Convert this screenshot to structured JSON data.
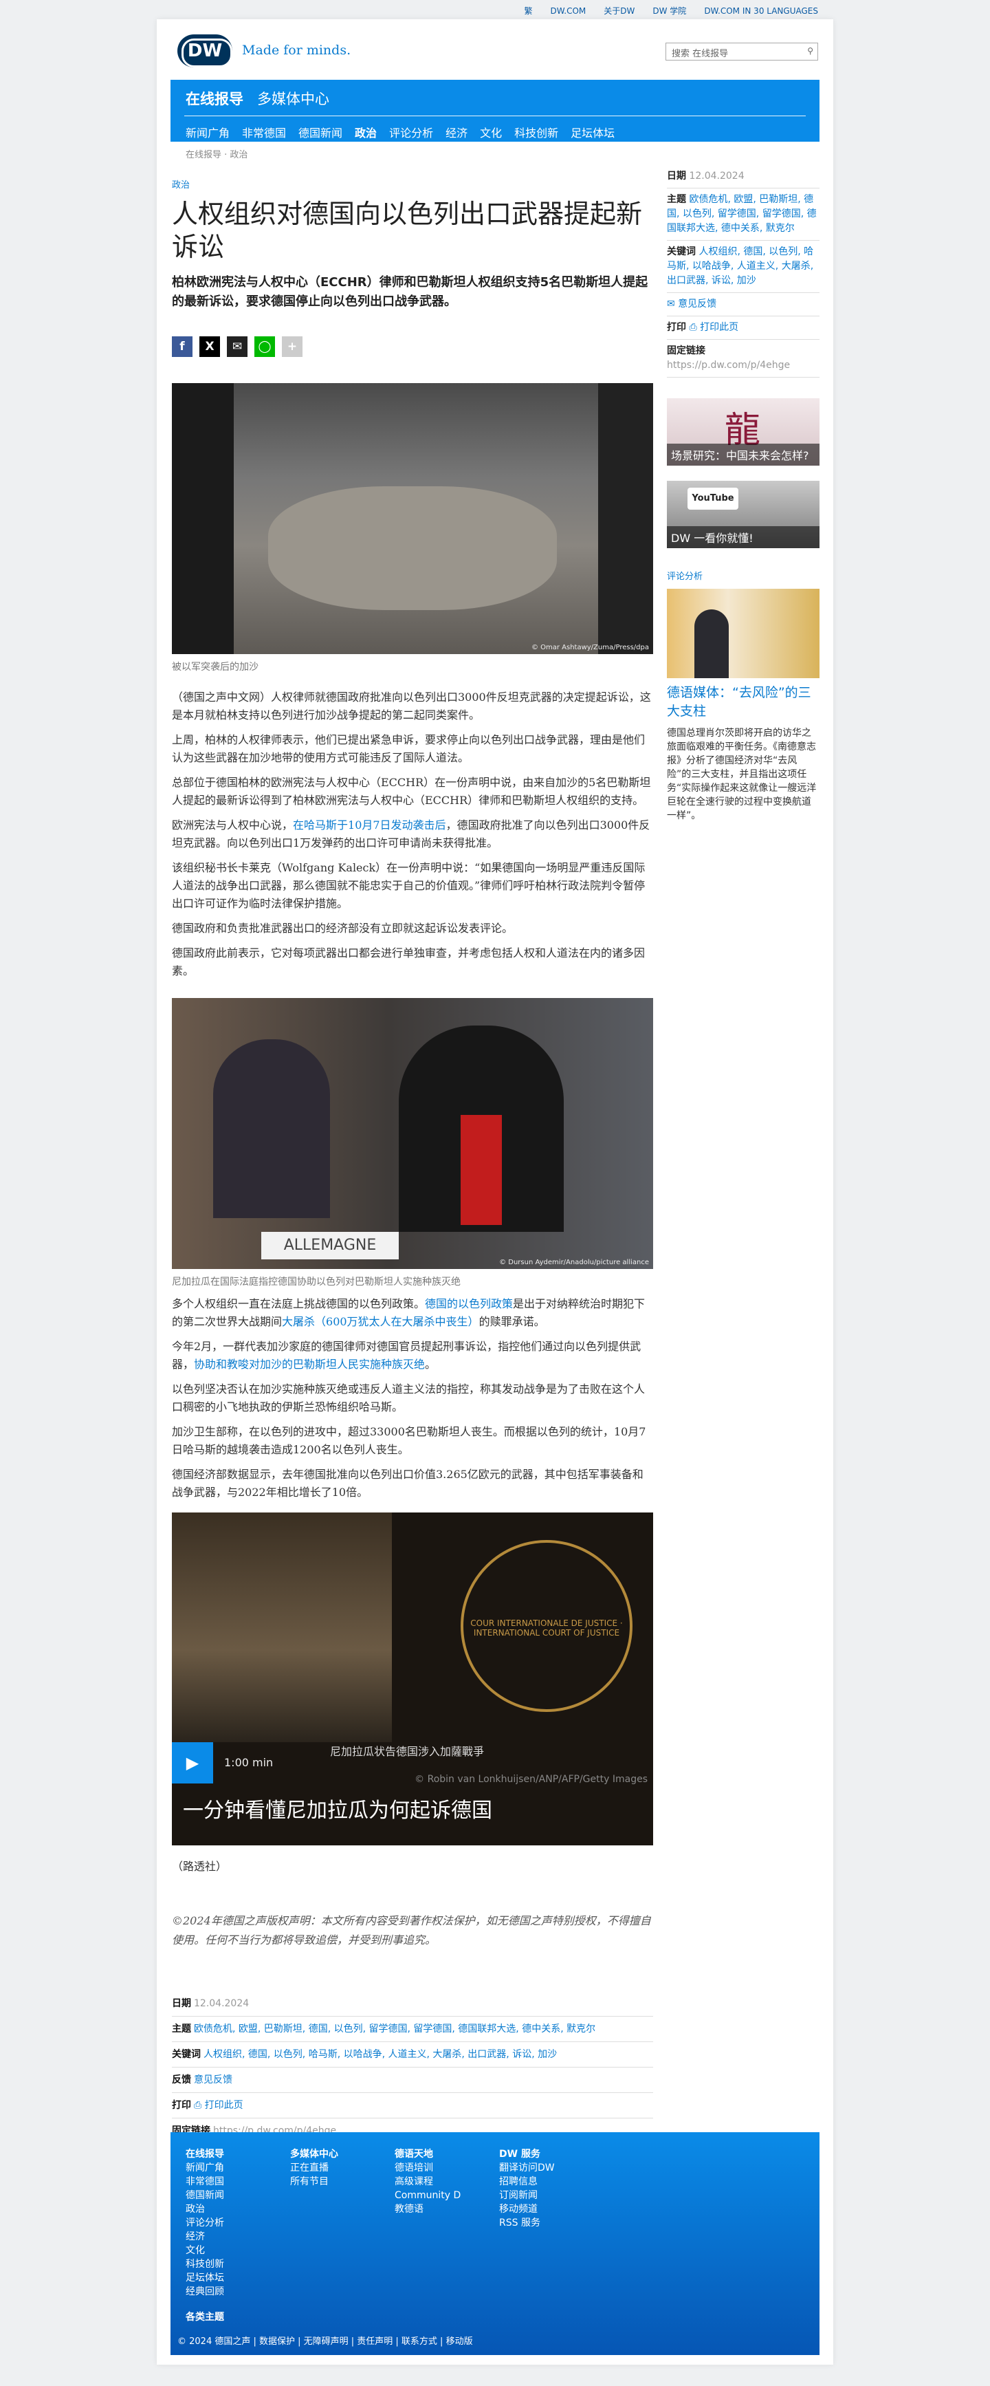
{
  "toplinks": [
    "繁",
    "DW.COM",
    "关于DW",
    "DW 学院",
    "DW.COM IN 30 LANGUAGES"
  ],
  "header": {
    "logo": "DW",
    "tagline": "Made for minds.",
    "search_placeholder": "搜索 在线报导",
    "search_icon": "magnifier-icon"
  },
  "nav": {
    "section1": "在线报导",
    "section2": "多媒体中心",
    "items": [
      "新闻广角",
      "非常德国",
      "德国新闻",
      "政治",
      "评论分析",
      "经济",
      "文化",
      "科技创新",
      "足坛体坛"
    ],
    "active": "政治"
  },
  "breadcrumb": "在线报导 · 政治",
  "article": {
    "kicker": "政治",
    "title": "人权组织对德国向以色列出口武器提起新诉讼",
    "lead": "柏林欧洲宪法与人权中心（ECCHR）律师和巴勒斯坦人权组织支持5名巴勒斯坦人提起的最新诉讼，要求德国停止向以色列出口战争武器。",
    "share": [
      "f",
      "X",
      "✉",
      "◯",
      "+"
    ],
    "img1": {
      "caption": "被以军突袭后的加沙",
      "credit": "© Omar Ashtawy/Zuma/Press/dpa"
    },
    "paras1": [
      "（德国之声中文网）人权律师就德国政府批准向以色列出口3000件反坦克武器的决定提起诉讼，这是本月就柏林支持以色列进行加沙战争提起的第二起同类案件。",
      "上周，柏林的人权律师表示，他们已提出紧急申诉，要求停止向以色列出口战争武器，理由是他们认为这些武器在加沙地带的使用方式可能违反了国际人道法。",
      "总部位于德国柏林的欧洲宪法与人权中心（ECCHR）在一份声明中说，由来自加沙的5名巴勒斯坦人提起的最新诉讼得到了柏林欧洲宪法与人权中心（ECCHR）律师和巴勒斯坦人权组织的支持。"
    ],
    "p4": {
      "pre": "欧洲宪法与人权中心说，",
      "link": "在哈马斯于10月7日发动袭击后",
      "post": "，德国政府批准了向以色列出口3000件反坦克武器。向以色列出口1万发弹药的出口许可申请尚未获得批准。"
    },
    "paras2": [
      "该组织秘书长卡莱克（Wolfgang Kaleck）在一份声明中说：“如果德国向一场明显严重违反国际人道法的战争出口武器，那么德国就不能忠实于自己的价值观。”律师们呼吁柏林行政法院判令暂停出口许可证作为临时法律保护措施。",
      "德国政府和负责批准武器出口的经济部没有立即就这起诉讼发表评论。",
      "德国政府此前表示，它对每项武器出口都会进行单独审查，并考虑包括人权和人道法在内的诸多因素。"
    ],
    "img2": {
      "caption": "尼加拉瓜在国际法庭指控德国协助以色列对巴勒斯坦人实施种族灭绝",
      "credit": "© Dursun Aydemir/Anadolu/picture alliance",
      "placard": "ALLEMAGNE"
    },
    "p8": {
      "pre": "多个人权组织一直在法庭上挑战德国的以色列政策。",
      "link1": "德国的以色列政策",
      "mid": "是出于对纳粹统治时期犯下的第二次世界大战期间",
      "link2": "大屠杀（600万犹太人在大屠杀中丧生）",
      "post": "的赎罪承诺。"
    },
    "p9": {
      "pre": "今年2月，一群代表加沙家庭的德国律师对德国官员提起刑事诉讼，指控他们通过向以色列提供武器，",
      "link": "协助和教唆对加沙的巴勒斯坦人民实施种族灭绝",
      "post": "。"
    },
    "paras3": [
      "以色列坚决否认在加沙实施种族灭绝或违反人道主义法的指控，称其发动战争是为了击败在这个人口稠密的小飞地执政的伊斯兰恐怖组织哈马斯。",
      "加沙卫生部称，在以色列的进攻中，超过33000名巴勒斯坦人丧生。而根据以色列的统计，10月7日哈马斯的越境袭击造成1200名以色列人丧生。",
      "德国经济部数据显示，去年德国批准向以色列出口价值3.265亿欧元的武器，其中包括军事装备和战争武器，与2022年相比增长了10倍。"
    ],
    "video": {
      "subtitle": "尼加拉瓜状告德国涉入加薩戰爭",
      "duration": "1:00 min",
      "title": "一分钟看懂尼加拉瓜为何起诉德国",
      "credit": "© Robin van Lonkhuijsen/ANP/AFP/Getty Images",
      "seal_text": "COUR INTERNATIONALE DE JUSTICE · INTERNATIONAL COURT OF JUSTICE"
    },
    "source": "（路透社）",
    "copyright": "©2024年德国之声版权声明：本文所有内容受到著作权法保护，如无德国之声特别授权，不得擅自使用。任何不当行为都将导致追偿，并受到刑事追究。",
    "meta": {
      "date_label": "日期",
      "date": "12.04.2024",
      "topic_label": "主题",
      "topics": "欧债危机, 欧盟, 巴勒斯坦, 德国, 以色列, 留学德国, 留学德国, 德国联邦大选, 德中关系, 默克尔",
      "kw_label": "关键词",
      "keywords": "人权组织, 德国, 以色列, 哈马斯, 以哈战争, 人道主义, 大屠杀, 出口武器, 诉讼, 加沙",
      "fb_label": "反馈",
      "feedback": "意见反馈",
      "print_label": "打印",
      "print": "打印此页",
      "link_label": "固定链接",
      "link": "https://p.dw.com/p/4ehge"
    }
  },
  "sidebar": {
    "date_label": "日期",
    "date": "12.04.2024",
    "topic_label": "主题",
    "topics": "欧债危机, 欧盟, 巴勒斯坦, 德国, 以色列, 留学德国, 留学德国, 德国联邦大选, 德中关系, 默克尔",
    "kw_label": "关键词",
    "keywords": "人权组织, 德国, 以色列, 哈马斯, 以哈战争, 人道主义, 大屠杀, 出口武器, 诉讼, 加沙",
    "feedback": "意见反馈",
    "print_label": "打印",
    "print": "打印此页",
    "link_label": "固定链接",
    "link": "https://p.dw.com/p/4ehge",
    "teaser1": "场景研究：中国未来会怎样?",
    "teaser2": "DW 一看你就懂!",
    "teaser2_logo": "YouTube",
    "kicker3": "评论分析",
    "title3": "德语媒体：“去风险”的三大支柱",
    "text3": "德国总理肖尔茨即将开启的访华之旅面临艰难的平衡任务。《南德意志报》分析了德国经济对华“去风险”的三大支柱，并且指出这项任务“实际操作起来这就像让一艘远洋巨轮在全速行驶的过程中变换航道一样”。"
  },
  "footer": {
    "col1": {
      "title": "在线报导",
      "items": [
        "新闻广角",
        "非常德国",
        "德国新闻",
        "政治",
        "评论分析",
        "经济",
        "文化",
        "科技创新",
        "足坛体坛",
        "经典回顾"
      ]
    },
    "col2": {
      "title": "多媒体中心",
      "items": [
        "正在直播",
        "所有节目"
      ]
    },
    "col3": {
      "title": "德语天地",
      "items": [
        "德语培训",
        "高级课程",
        "Community D",
        "教德语"
      ]
    },
    "col4": {
      "title": "DW 服务",
      "items": [
        "翻译访问DW",
        "招聘信息",
        "订阅新闻",
        "移动频道",
        "RSS 服务"
      ]
    },
    "topics": "各类主题",
    "bottom": "© 2024 德国之声 | 数据保护 | 无障碍声明 | 责任声明 | 联系方式 | 移动版"
  }
}
